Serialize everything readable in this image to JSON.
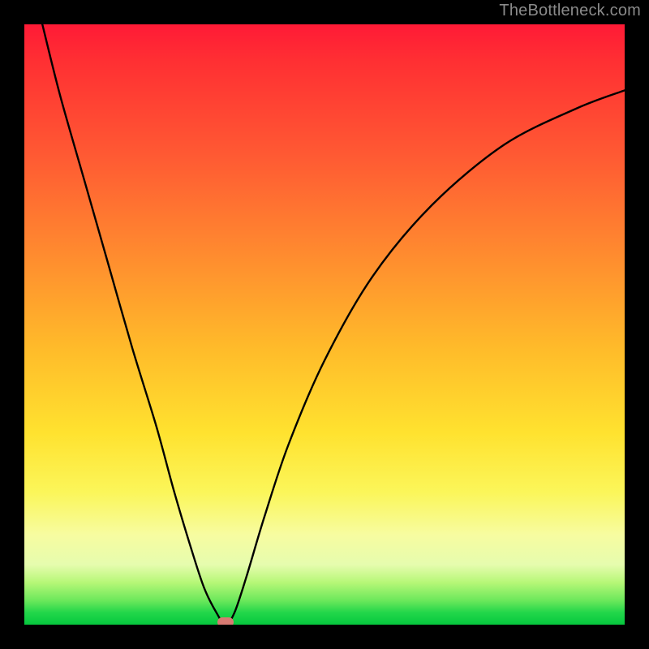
{
  "watermark": "TheBottleneck.com",
  "chart_data": {
    "type": "line",
    "title": "",
    "xlabel": "",
    "ylabel": "",
    "xlim": [
      0,
      100
    ],
    "ylim": [
      0,
      100
    ],
    "grid": false,
    "legend": false,
    "background_gradient": {
      "direction": "vertical",
      "stops": [
        {
          "pos": 0.0,
          "color": "#ff1a36"
        },
        {
          "pos": 0.22,
          "color": "#ff5a33"
        },
        {
          "pos": 0.54,
          "color": "#ffbb2a"
        },
        {
          "pos": 0.78,
          "color": "#fbf65a"
        },
        {
          "pos": 0.9,
          "color": "#e6fcae"
        },
        {
          "pos": 0.96,
          "color": "#6be85b"
        },
        {
          "pos": 1.0,
          "color": "#06c83e"
        }
      ]
    },
    "series": [
      {
        "name": "bottleneck-curve",
        "color": "#000000",
        "x": [
          3,
          6,
          10,
          14,
          18,
          22,
          25,
          28,
          30,
          32,
          33.5,
          35,
          37,
          40,
          44,
          50,
          58,
          68,
          80,
          92,
          100
        ],
        "y": [
          100,
          88,
          74,
          60,
          46,
          33,
          22,
          12,
          6,
          2,
          0,
          2,
          8,
          18,
          30,
          44,
          58,
          70,
          80,
          86,
          89
        ]
      }
    ],
    "marker": {
      "x": 33.5,
      "y": 0,
      "color": "#d87a72"
    }
  }
}
